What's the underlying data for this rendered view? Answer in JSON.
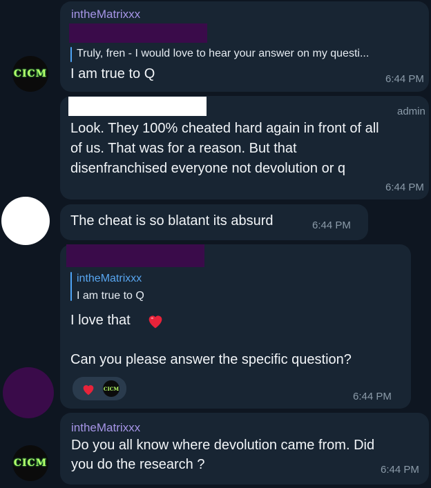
{
  "messages": [
    {
      "sender": "intheMatrixxx",
      "reply_text": "Truly, fren - I would love to hear your answer on my questi...",
      "text": "I am true to Q",
      "time": "6:44 PM"
    },
    {
      "role": "admin",
      "lines": [
        "Look. They 100% cheated hard again in front of all",
        "of us. That was for a reason. But that",
        "disenfranchised everyone not devolution or q"
      ],
      "time": "6:44 PM"
    },
    {
      "text": "The cheat is so blatant its absurd",
      "time": "6:44 PM"
    },
    {
      "reply_name": "intheMatrixxx",
      "reply_text": "I am true to Q",
      "line1": "I love that",
      "line2": "Can you please answer the specific question?",
      "time": "6:44 PM"
    },
    {
      "sender": "intheMatrixxx",
      "lines": [
        "Do you all know where devolution came from. Did",
        "you do the research ?"
      ],
      "time": "6:44 PM"
    }
  ],
  "avatar_logo": {
    "text": "CICM",
    "sub": ""
  },
  "icons": {
    "heart": "heart-emoji",
    "reaction_heart": "heart-reaction",
    "colors": {
      "bubble": "#182533",
      "bg": "#0e1621",
      "sender": "#a695e7",
      "reply_bar": "#4ea4f6"
    }
  }
}
